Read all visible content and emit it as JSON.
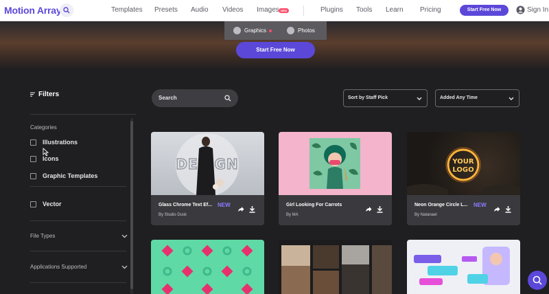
{
  "header": {
    "logo": "Motion Array",
    "nav": [
      "Templates",
      "Presets",
      "Audio",
      "Videos",
      "Images",
      "Plugins",
      "Tools",
      "Learn",
      "Pricing"
    ],
    "new_badge": "NEW",
    "cta": "Start Free Now",
    "signin": "Sign In"
  },
  "subtabs": [
    "Graphics",
    "Photos"
  ],
  "hero": {
    "cta": "Start Free Now"
  },
  "sidebar": {
    "title": "Filters",
    "categories_heading": "Categories",
    "categories": [
      "Illustrations",
      "Icons",
      "Graphic Templates",
      "Vector"
    ],
    "accordions": [
      "File Types",
      "Applications Supported"
    ]
  },
  "toolbar": {
    "search_label": "Search",
    "sort_label": "Sort by Staff Pick",
    "time_label": "Added Any Time"
  },
  "cards": [
    {
      "title": "Glass Chrome Text Ef...",
      "author": "By Studio Dusk",
      "badge": "NEW"
    },
    {
      "title": "Girl Looking For Carrots",
      "author": "By MA",
      "badge": ""
    },
    {
      "title": "Neon Orange Circle L...",
      "author": "By Natanael",
      "badge": "NEW",
      "logo_text_1": "YOUR",
      "logo_text_2": "LOGO"
    }
  ],
  "colors": {
    "brand": "#5b48d9",
    "new_badge": "#ff4d6a",
    "new_text": "#8a7cff",
    "background": "#1f1f21"
  }
}
